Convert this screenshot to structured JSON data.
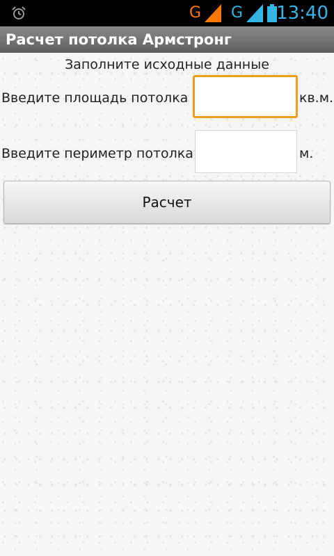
{
  "status_bar": {
    "network_1": "G",
    "network_2": "G",
    "time": "13:40",
    "network_1_color": "#ff7700",
    "network_2_color": "#33b5e5",
    "icons": [
      "alarm-icon",
      "signal-icon",
      "battery-icon"
    ]
  },
  "app": {
    "title": "Расчет потолка Армстронг"
  },
  "form": {
    "subtitle": "Заполните исходные данные",
    "area_label": "Введите площадь потолка",
    "area_value": "",
    "area_unit": "кв.м.",
    "perimeter_label": "Введите периметр потолка",
    "perimeter_value": "",
    "perimeter_unit": "м.",
    "calc_button": "Расчет"
  },
  "colors": {
    "focus": "#f39c1f",
    "clock": "#33b5e5"
  }
}
